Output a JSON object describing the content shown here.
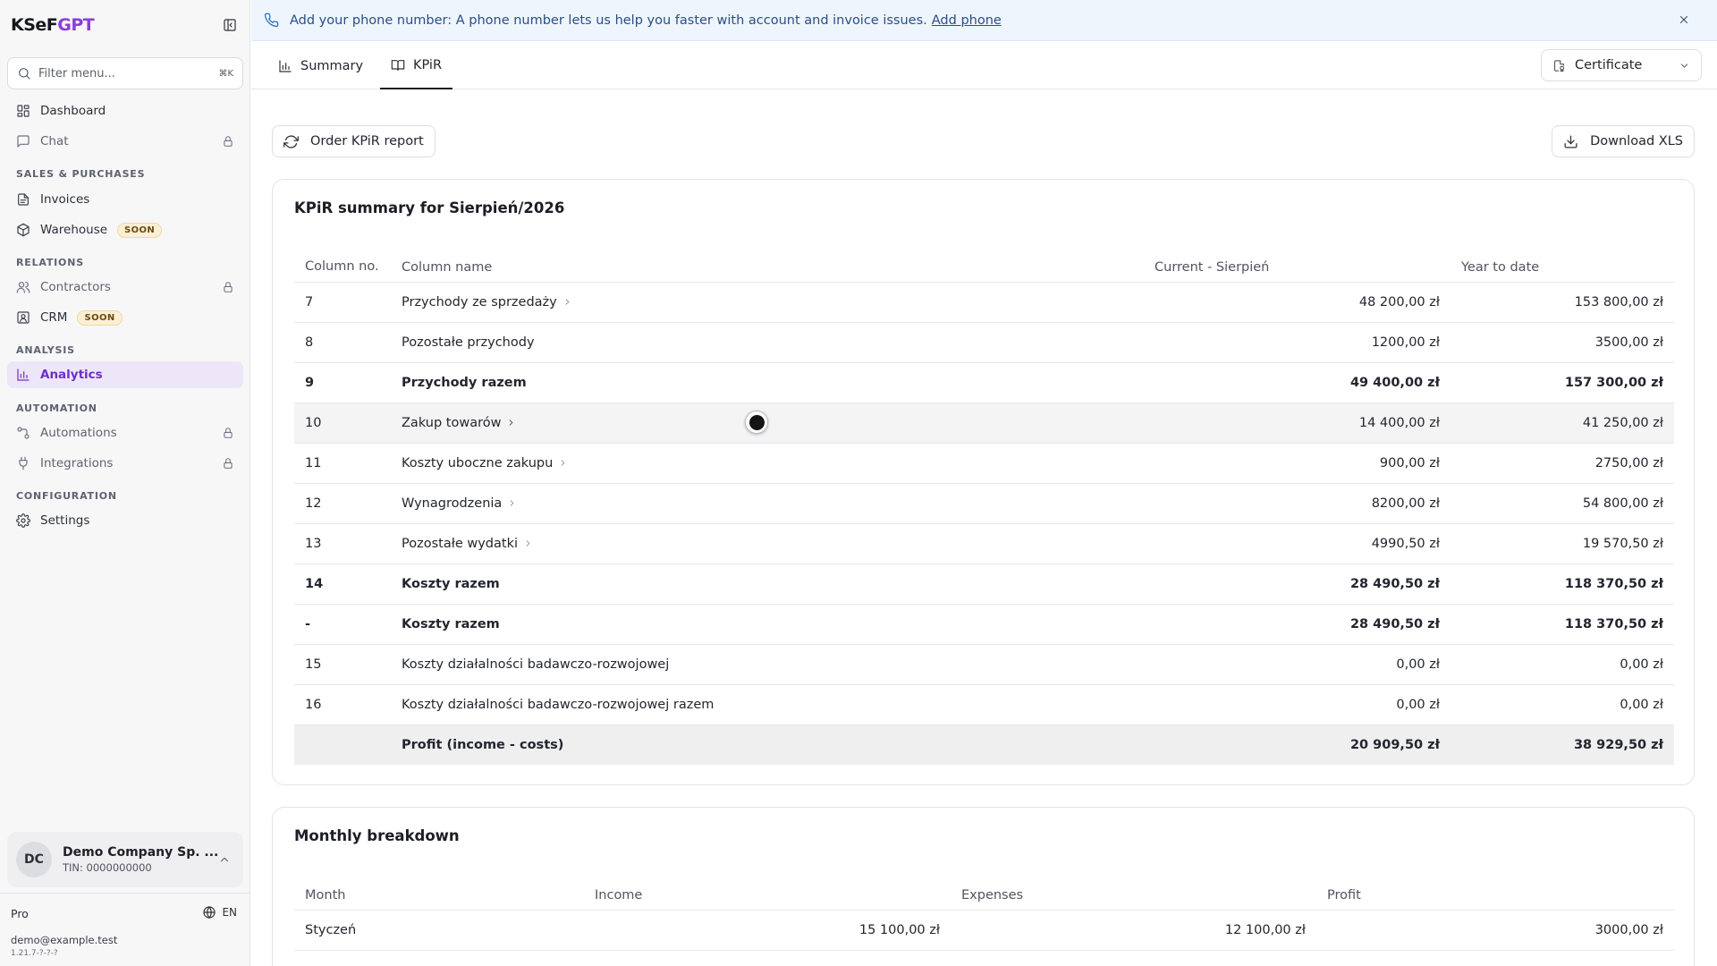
{
  "brand": {
    "name_main": "KSeF",
    "name_accent": "GPT"
  },
  "sidebar": {
    "filter_placeholder": "Filter menu...",
    "filter_shortcut": "⌘K",
    "items": [
      {
        "label": "Dashboard",
        "icon": "dashboard-icon"
      },
      {
        "label": "Chat",
        "icon": "chat-icon",
        "locked": true
      },
      {
        "label": "Invoices",
        "icon": "invoice-icon"
      },
      {
        "label": "Warehouse",
        "icon": "warehouse-icon",
        "badge": "SOON"
      },
      {
        "label": "Contractors",
        "icon": "contractors-icon",
        "locked": true
      },
      {
        "label": "CRM",
        "icon": "crm-icon",
        "badge": "SOON"
      },
      {
        "label": "Analytics",
        "icon": "analytics-icon",
        "active": true
      },
      {
        "label": "Automations",
        "icon": "automations-icon",
        "locked": true
      },
      {
        "label": "Integrations",
        "icon": "integrations-icon",
        "locked": true
      },
      {
        "label": "Settings",
        "icon": "settings-icon"
      }
    ],
    "sections": [
      "SALES & PURCHASES",
      "RELATIONS",
      "ANALYSIS",
      "AUTOMATION",
      "CONFIGURATION"
    ],
    "company": {
      "initials": "DC",
      "name": "Demo Company Sp. ...",
      "tin": "TIN: 0000000000"
    },
    "plan": "Pro",
    "language": "EN",
    "email": "demo@example.test",
    "version": "1.21.7-?-?-?"
  },
  "banner": {
    "text": "Add your phone number: A phone number lets us help you faster with account and invoice issues.",
    "link": "Add phone"
  },
  "tabs": [
    {
      "label": "Summary",
      "icon": "bar-chart-icon"
    },
    {
      "label": "KPiR",
      "icon": "book-icon",
      "active": true
    }
  ],
  "certificate_select": "Certificate",
  "actions": {
    "order_report": "Order KPiR report",
    "download_xls": "Download XLS"
  },
  "kpir": {
    "title": "KPiR summary for Sierpień/2026",
    "columns": [
      "Column no.",
      "Column name",
      "Current - Sierpień",
      "Year to date"
    ],
    "rows": [
      {
        "no": "7",
        "name": "Przychody ze sprzedaży",
        "current": "48 200,00 zł",
        "ytd": "153 800,00 zł",
        "chevron": true
      },
      {
        "no": "8",
        "name": "Pozostałe przychody",
        "current": "1200,00 zł",
        "ytd": "3500,00 zł"
      },
      {
        "no": "9",
        "name": "Przychody razem",
        "current": "49 400,00 zł",
        "ytd": "157 300,00 zł",
        "bold": true
      },
      {
        "no": "10",
        "name": "Zakup towarów",
        "current": "14 400,00 zł",
        "ytd": "41 250,00 zł",
        "chevron": true,
        "hover": true
      },
      {
        "no": "11",
        "name": "Koszty uboczne zakupu",
        "current": "900,00 zł",
        "ytd": "2750,00 zł",
        "chevron": true
      },
      {
        "no": "12",
        "name": "Wynagrodzenia",
        "current": "8200,00 zł",
        "ytd": "54 800,00 zł",
        "chevron": true
      },
      {
        "no": "13",
        "name": "Pozostałe wydatki",
        "current": "4990,50 zł",
        "ytd": "19 570,50 zł",
        "chevron": true
      },
      {
        "no": "14",
        "name": "Koszty razem",
        "current": "28 490,50 zł",
        "ytd": "118 370,50 zł",
        "bold": true
      },
      {
        "no": "-",
        "name": "Koszty razem",
        "current": "28 490,50 zł",
        "ytd": "118 370,50 zł",
        "bold": true
      },
      {
        "no": "15",
        "name": "Koszty działalności badawczo-rozwojowej",
        "current": "0,00 zł",
        "ytd": "0,00 zł"
      },
      {
        "no": "16",
        "name": "Koszty działalności badawczo-rozwojowej razem",
        "current": "0,00 zł",
        "ytd": "0,00 zł"
      },
      {
        "no": "",
        "name": "Profit (income - costs)",
        "current": "20 909,50 zł",
        "ytd": "38 929,50 zł",
        "profit": true
      }
    ]
  },
  "monthly": {
    "title": "Monthly breakdown",
    "columns": [
      "Month",
      "Income",
      "Expenses",
      "Profit"
    ],
    "rows": [
      {
        "month": "Styczeń",
        "income": "15 100,00 zł",
        "expenses": "12 100,00 zł",
        "profit": "3000,00 zł"
      }
    ]
  }
}
